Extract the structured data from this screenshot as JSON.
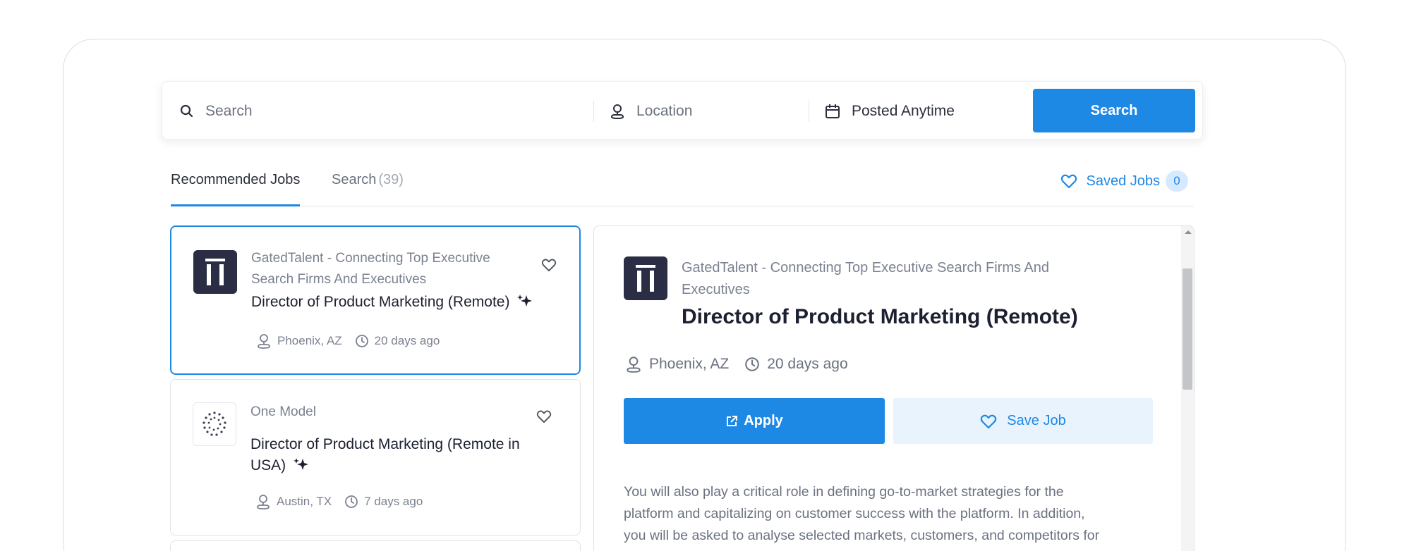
{
  "search": {
    "keyword_placeholder": "Search",
    "location_placeholder": "Location",
    "date_filter": "Posted Anytime",
    "button_label": "Search"
  },
  "tabs": {
    "recommended": "Recommended Jobs",
    "search_label": "Search",
    "search_count": "(39)"
  },
  "saved_jobs": {
    "label": "Saved Jobs",
    "count": "0"
  },
  "jobs": [
    {
      "company_line1": "GatedTalent - Connecting Top Executive",
      "company_line2": "Search Firms And Executives",
      "title": "Director of Product Marketing (Remote)",
      "location": "Phoenix, AZ",
      "posted": "20 days ago"
    },
    {
      "company": "One Model",
      "title_line1": "Director of Product Marketing (Remote in",
      "title_line2": "USA)",
      "location": "Austin, TX",
      "posted": "7 days ago"
    }
  ],
  "detail": {
    "company_line1": "GatedTalent - Connecting Top Executive Search Firms And",
    "company_line2": "Executives",
    "title": "Director of Product Marketing (Remote)",
    "location": "Phoenix, AZ",
    "posted": "20 days ago",
    "apply_label": "Apply",
    "save_label": "Save Job",
    "description_lines": [
      "You will also play a critical role in defining go-to-market strategies for the",
      "platform and capitalizing on customer success with the platform. In addition,",
      "you will be asked to analyse selected markets, customers, and competitors for"
    ]
  },
  "colors": {
    "accent": "#1e88e5",
    "accent_light": "#e8f3fd",
    "logo_dark": "#2a2d44"
  }
}
